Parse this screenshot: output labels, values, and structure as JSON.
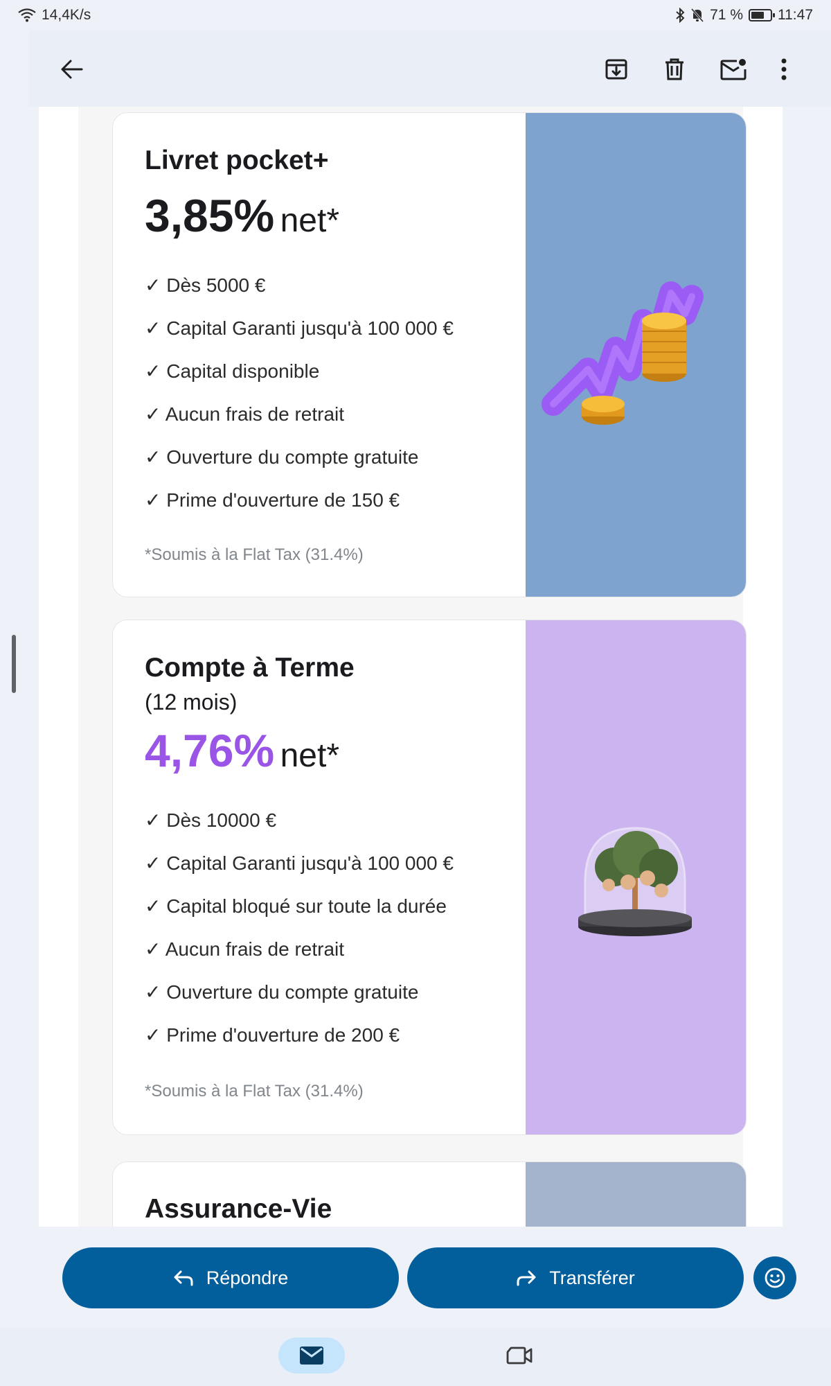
{
  "status": {
    "net_speed": "14,4K/s",
    "battery": "71 %",
    "battery_level": 0.71,
    "time": "11:47"
  },
  "toolbar": {
    "icons": [
      "back-arrow-icon",
      "archive-icon",
      "delete-icon",
      "mark-unread-icon",
      "more-vert-icon"
    ]
  },
  "cards": [
    {
      "title": "Livret pocket+",
      "rate": "3,85%",
      "rate_suffix": "net*",
      "rate_color": "#1b1b1f",
      "image_bg": "#7fa3cf",
      "features": [
        "✓ Dès 5000 €",
        "✓ Capital Garanti jusqu'à 100 000 €",
        "✓ Capital disponible",
        "✓ Aucun frais de retrait",
        "✓ Ouverture du compte gratuite",
        "✓ Prime d'ouverture de 150 €"
      ],
      "footnote": "*Soumis à la Flat Tax (31.4%)"
    },
    {
      "title": "Compte à Terme",
      "subtitle": "(12 mois)",
      "rate": "4,76%",
      "rate_suffix": "net*",
      "rate_color": "#9a55e6",
      "image_bg": "#cbb4ef",
      "features": [
        "✓ Dès 10000 €",
        "✓ Capital Garanti jusqu'à 100 000 €",
        "✓ Capital bloqué sur toute la durée",
        "✓ Aucun frais de retrait",
        "✓ Ouverture du compte gratuite",
        "✓ Prime d'ouverture de 200 €"
      ],
      "footnote": "*Soumis à la Flat Tax (31.4%)"
    },
    {
      "title": "Assurance-Vie",
      "image_bg": "#a3b3cb"
    }
  ],
  "actions": {
    "reply_label": "Répondre",
    "forward_label": "Transférer",
    "accent": "#035f9c"
  },
  "bottom_nav": {
    "items": [
      "mail-icon",
      "video-call-icon"
    ],
    "active_bg": "#c4e5fb"
  }
}
